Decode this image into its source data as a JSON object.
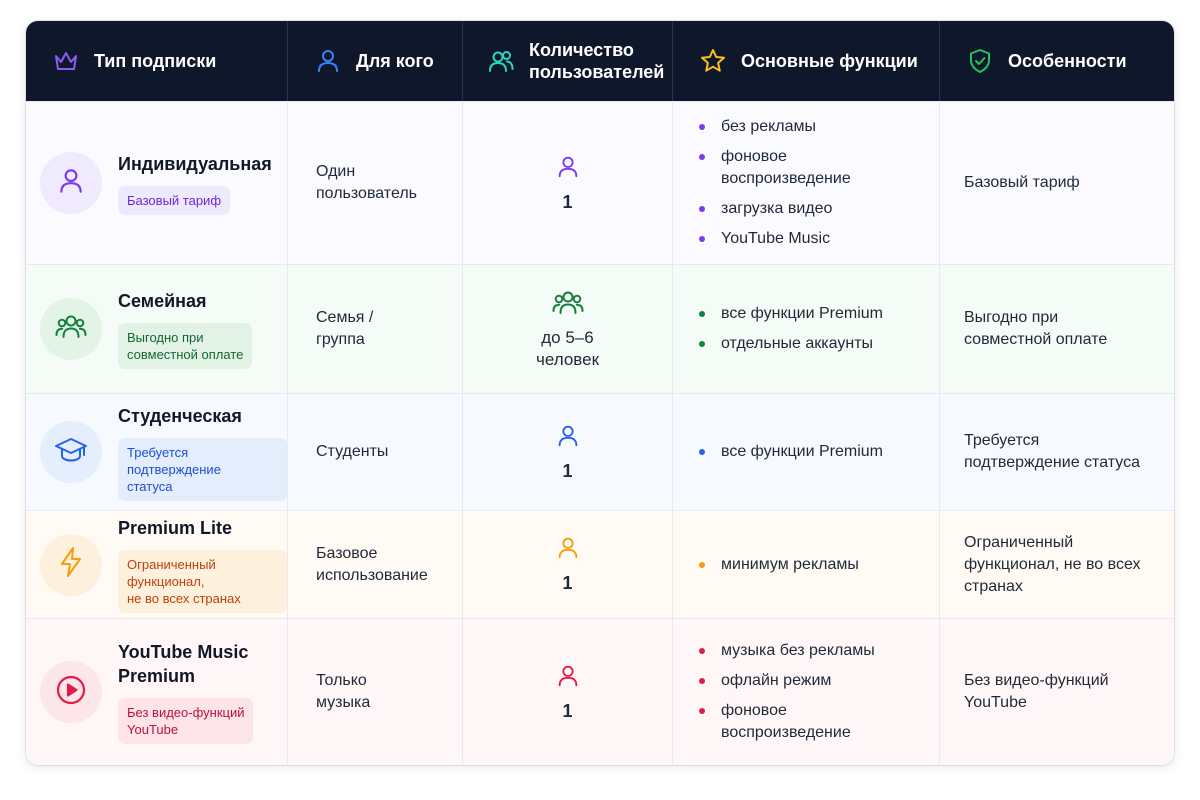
{
  "header": {
    "col_type": "Тип подписки",
    "col_for": "Для кого",
    "col_count": "Количество\nпользователей",
    "col_features": "Основные функции",
    "col_specifics": "Особенности"
  },
  "colors": {
    "header_bg": "#0f172a",
    "purple": "#7c3aed",
    "green": "#15803d",
    "blue": "#2563eb",
    "orange": "#f59e0b",
    "red": "#e11d48"
  },
  "rows": [
    {
      "icon": "user-icon",
      "name": "Индивидуальная",
      "badge": "Базовый тариф",
      "for": "Один\nпользователь",
      "count_icon": "user-icon",
      "count": "1",
      "features": [
        "без рекламы",
        "фоновое\nвоспроизведение",
        "загрузка видео",
        "YouTube Music"
      ],
      "specifics": "Базовый тариф",
      "accent": "#7c3aed",
      "row_bg": "#fafaff",
      "circle_bg": "#efeafe",
      "badge_bg": "#efe9fd",
      "badge_color": "#6d28d9"
    },
    {
      "icon": "users-icon",
      "name": "Семейная",
      "badge": "Выгодно при\nсовместной оплате",
      "for": "Семья /\nгруппа",
      "count_icon": "users-icon",
      "count": "до 5–6\nчеловек",
      "features": [
        "все функции Premium",
        "отдельные аккаунты"
      ],
      "specifics": "Выгодно при\nсовместной оплате",
      "accent": "#15803d",
      "row_bg": "#f5fbf6",
      "circle_bg": "#e3f4e7",
      "badge_bg": "#e2f3e6",
      "badge_color": "#166534"
    },
    {
      "icon": "graduation-cap-icon",
      "name": "Студенческая",
      "badge": "Требуется подтверждение\nстатуса",
      "for": "Студенты",
      "count_icon": "user-icon",
      "count": "1",
      "features": [
        "все функции Premium"
      ],
      "specifics": "Требуется\nподтверждение статуса",
      "accent": "#2563eb",
      "row_bg": "#f6f9fe",
      "circle_bg": "#e5eefc",
      "badge_bg": "#e3edfc",
      "badge_color": "#1d4ed8"
    },
    {
      "icon": "lightning-icon",
      "name": "Premium Lite",
      "badge": "Ограниченный функционал,\nне во всех странах",
      "for": "Базовое\nиспользование",
      "count_icon": "user-icon",
      "count": "1",
      "features": [
        "минимум рекламы"
      ],
      "specifics": "Ограниченный\nфункционал, не во всех\nстранах",
      "accent": "#f59e0b",
      "row_bg": "#fffbf4",
      "circle_bg": "#fdf1de",
      "badge_bg": "#fdf0dc",
      "badge_color": "#c2410c"
    },
    {
      "icon": "play-circle-icon",
      "name": "YouTube Music\nPremium",
      "badge": "Без видео-функций\nYouTube",
      "for": "Только\nмузыка",
      "count_icon": "user-icon",
      "count": "1",
      "features": [
        "музыка без рекламы",
        "офлайн режим",
        "фоновое\nвоспроизведение"
      ],
      "specifics": "Без видео-функций\nYouTube",
      "accent": "#e11d48",
      "row_bg": "#fff6f7",
      "circle_bg": "#fde6ea",
      "badge_bg": "#fde4e8",
      "badge_color": "#be123c"
    }
  ]
}
